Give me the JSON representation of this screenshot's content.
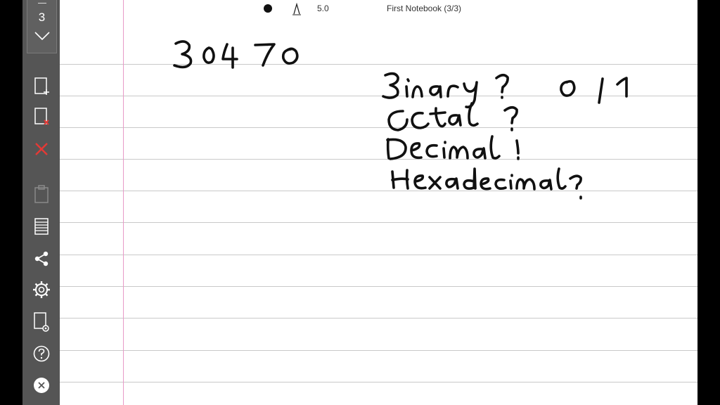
{
  "page_nav": {
    "current_page": "3"
  },
  "toolbar": {
    "pen_size": "5.0",
    "notebook_title": "First Notebook (3/3)"
  },
  "sidebar": {
    "tools": [
      {
        "name": "add-page-icon"
      },
      {
        "name": "delete-page-icon"
      },
      {
        "name": "close-x-icon"
      },
      {
        "name": "clipboard-icon"
      },
      {
        "name": "paper-style-icon"
      },
      {
        "name": "share-icon"
      },
      {
        "name": "settings-gear-icon"
      },
      {
        "name": "page-settings-icon"
      },
      {
        "name": "help-icon"
      },
      {
        "name": "exit-icon"
      }
    ]
  },
  "handwriting": {
    "number": "30470",
    "lines": [
      "Binary ?",
      "Octal ?",
      "Decimal ?",
      "Hexadecimal ?"
    ],
    "binary_digits": "0 1"
  },
  "colors": {
    "sidebar": "#555555",
    "rule": "#c9c9c9",
    "margin": "#e89ac8",
    "delete_red": "#e53935"
  }
}
